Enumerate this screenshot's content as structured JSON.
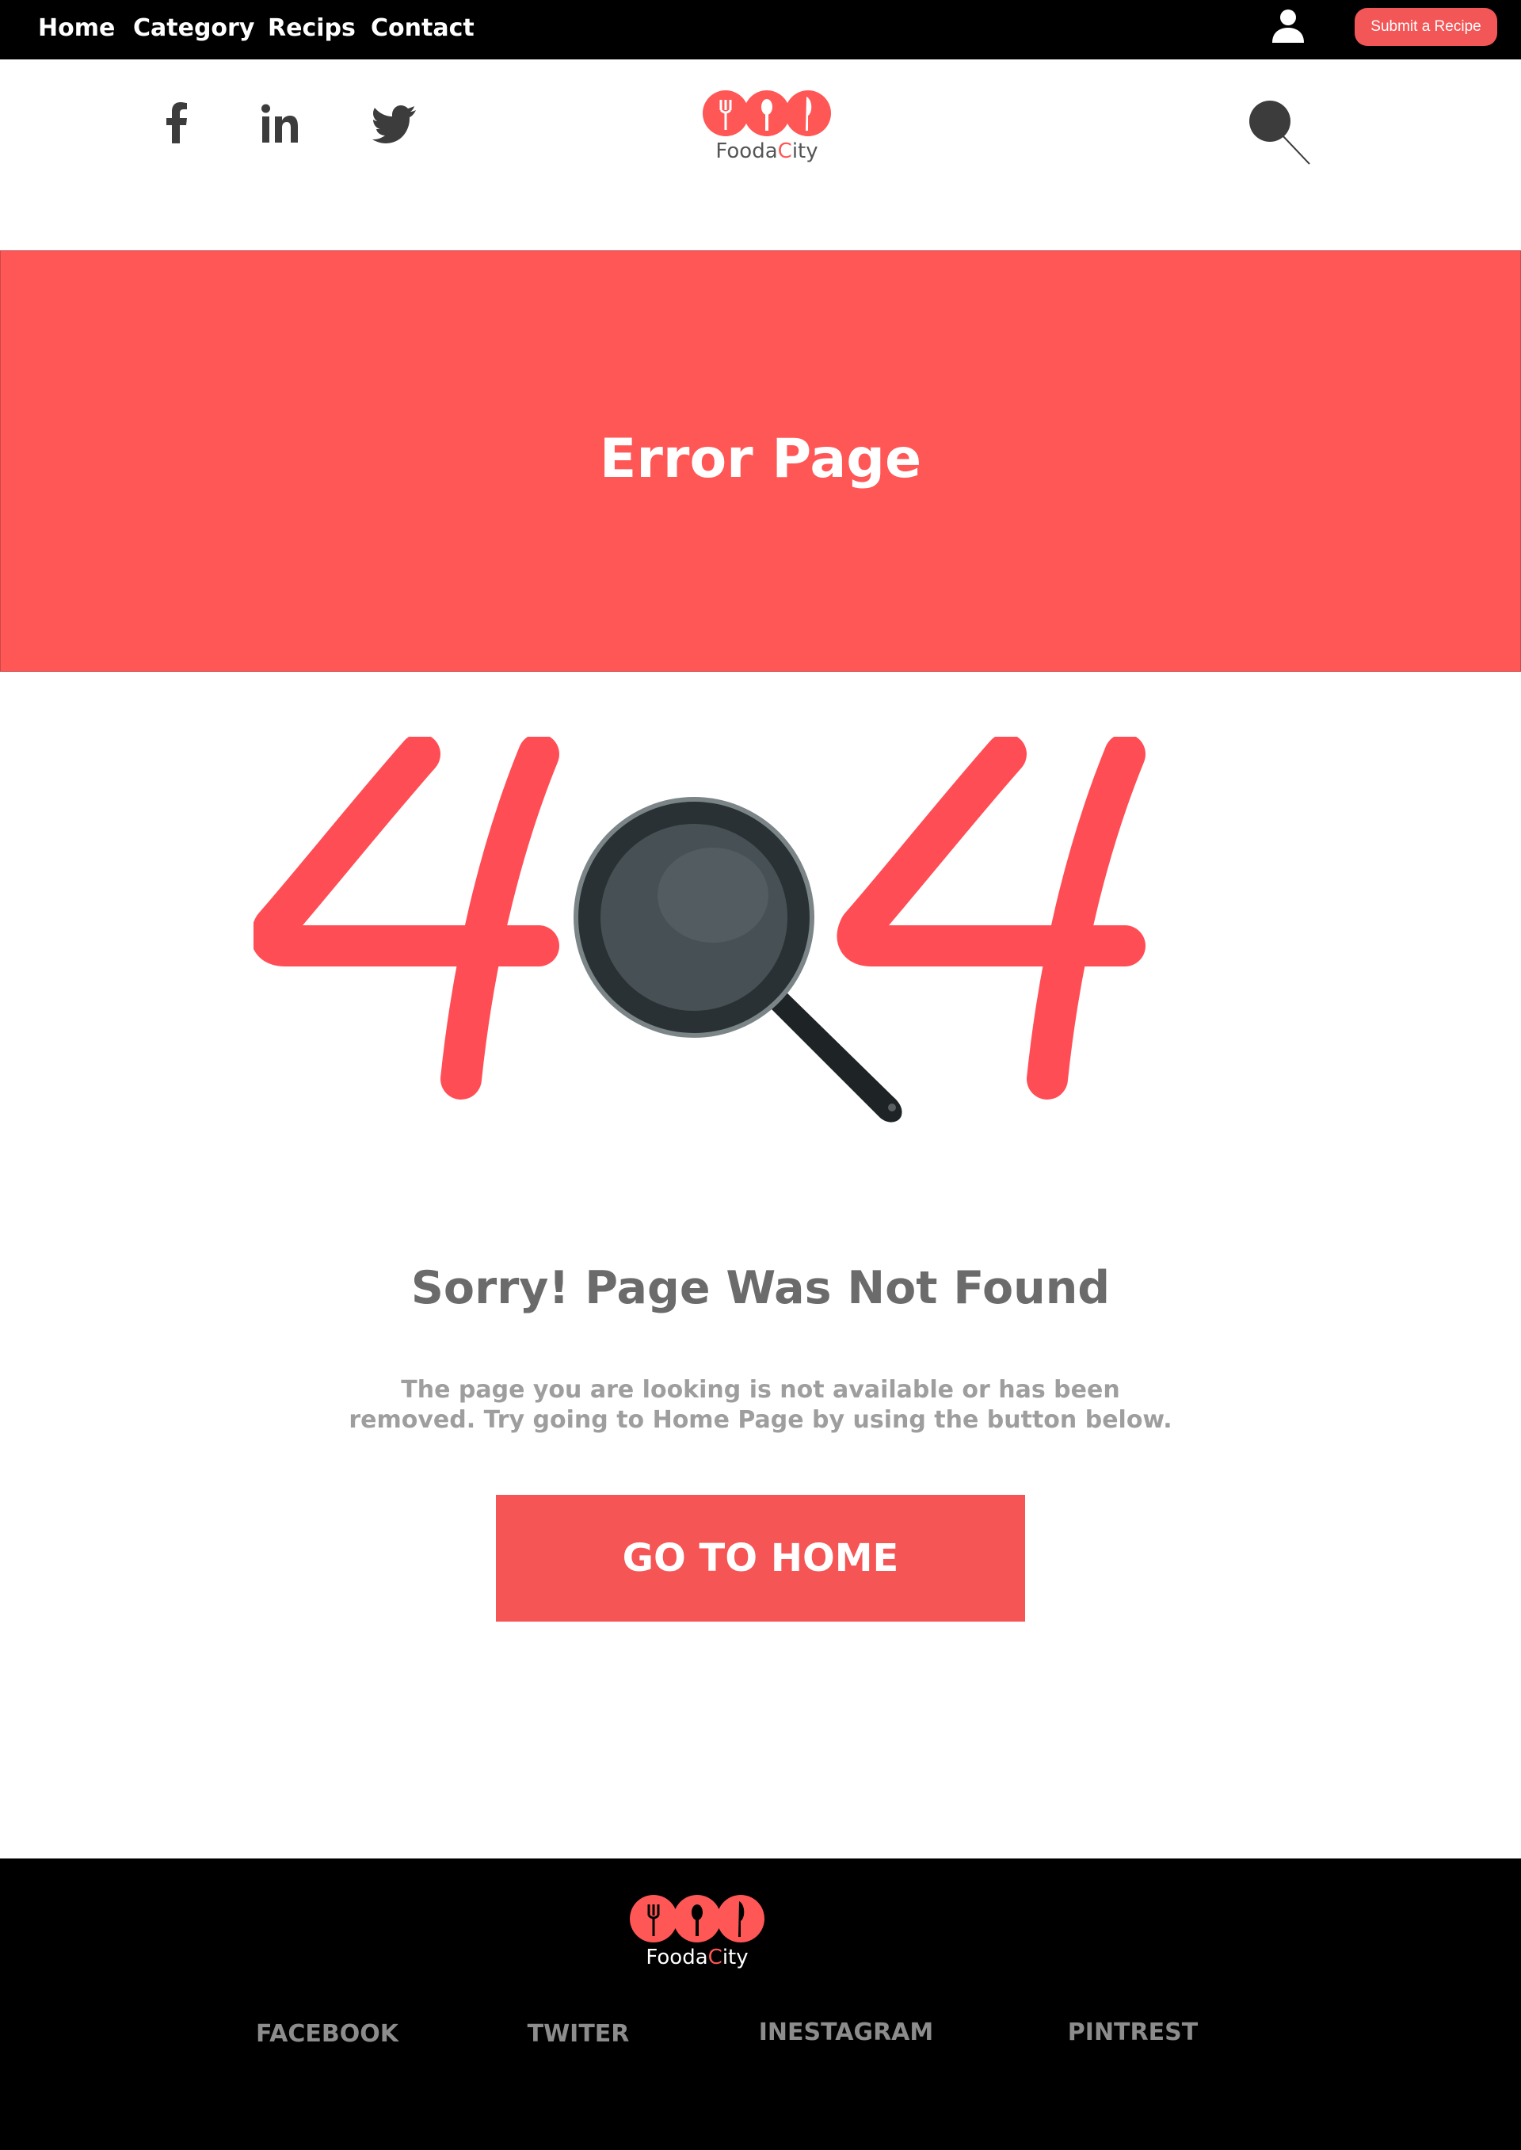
{
  "nav": {
    "home": "Home",
    "category": "Category",
    "recipes": "Recips",
    "contact": "Contact",
    "submit_label": "Submit a Recipe"
  },
  "brand": {
    "name_part1": "Fooda",
    "name_accent": "C",
    "name_part2": "ity",
    "accent_color": "#ff5656"
  },
  "social_icons": [
    "facebook-icon",
    "linkedin-icon",
    "twitter-icon"
  ],
  "banner": {
    "title": "Error Page"
  },
  "error": {
    "code_left": "4",
    "code_right": "4",
    "title": "Sorry! Page Was Not Found",
    "message": "The page you are looking is not available or has been removed. Try going to Home Page by using the button below.",
    "button_label": "GO TO HOME"
  },
  "footer": {
    "links": [
      "FACEBOOK",
      "TWITER",
      "INESTAGRAM",
      "PINTREST"
    ]
  }
}
